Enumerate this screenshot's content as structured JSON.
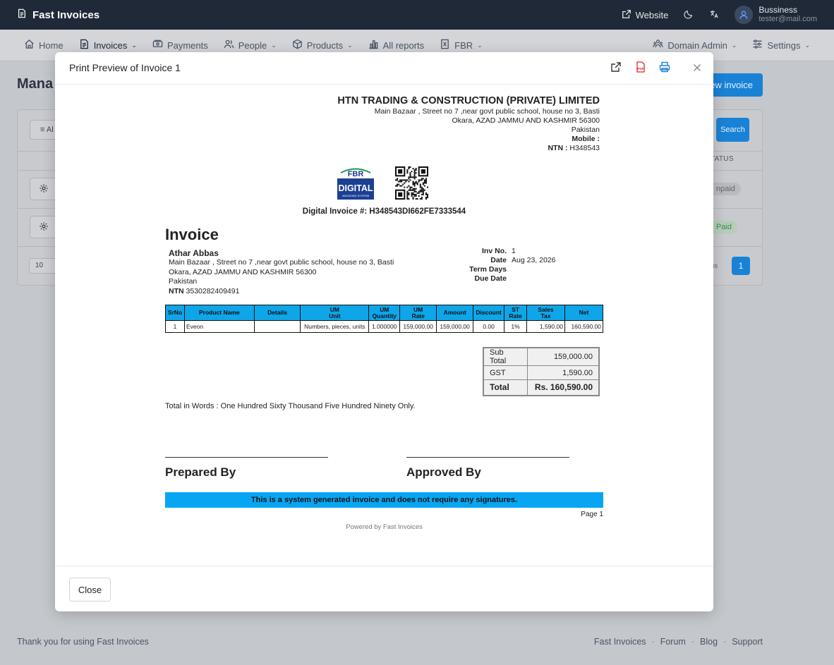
{
  "app": {
    "title": "Fast Invoices"
  },
  "topbar": {
    "website_label": "Website",
    "user_name": "Bussiness",
    "user_email": "tester@mail.com"
  },
  "nav": {
    "items": [
      {
        "label": "Home",
        "icon": "home-icon"
      },
      {
        "label": "Invoices",
        "icon": "file-icon"
      },
      {
        "label": "Payments",
        "icon": "payments-icon"
      },
      {
        "label": "People",
        "icon": "people-icon"
      },
      {
        "label": "Products",
        "icon": "box-icon"
      },
      {
        "label": "All reports",
        "icon": "chart-icon"
      },
      {
        "label": "FBR",
        "icon": "receipt-icon"
      }
    ],
    "right": [
      {
        "label": "Domain Admin",
        "icon": "team-icon"
      },
      {
        "label": "Settings",
        "icon": "sliders-icon"
      }
    ]
  },
  "page": {
    "title_partial": "Mana",
    "new_button": "ew invoice",
    "filter_partial": "≡ Al",
    "search_button": "Search",
    "status_header": "TATUS",
    "rows": [
      {
        "status": "npaid"
      },
      {
        "status": "Paid"
      }
    ],
    "per_page": "10",
    "items_partial": "ms",
    "current_page": "1"
  },
  "modal": {
    "title": "Print Preview of Invoice 1",
    "close_button": "Close"
  },
  "invoice": {
    "company": {
      "name": "HTN TRADING & CONSTRUCTION (PRIVATE) LIMITED",
      "address1": "Main Bazaar , Street no 7 ,near govt public school, house no 3, Basti",
      "address2": "Okara, AZAD JAMMU AND KASHMIR 56300",
      "country": "Pakistan",
      "mobile_label": "Mobile :",
      "ntn_label": "NTN :",
      "ntn": "H348543"
    },
    "fbr_logo": {
      "top": "FBR",
      "main": "DIGITAL",
      "sub": "INVOICING SYSTEM"
    },
    "digital_invoice": "Digital Invoice #: H348543DI662FE7333544",
    "heading": "Invoice",
    "customer": {
      "name": "Athar Abbas",
      "address1": "Main Bazaar , Street no 7 ,near govt public school, house no 3, Basti",
      "address2": "Okara, AZAD JAMMU AND KASHMIR 56300",
      "country": "Pakistan",
      "ntn_label": "NTN",
      "ntn": "3530282409491"
    },
    "meta": {
      "inv_no_label": "Inv No.",
      "inv_no": "1",
      "date_label": "Date",
      "date": "Aug 23, 2026",
      "term_days_label": "Term Days",
      "term_days": "",
      "due_date_label": "Due Date",
      "due_date": ""
    },
    "columns": [
      "SrNo",
      "Product Name",
      "Details",
      "UM\nUnit",
      "UM\nQuantity",
      "UM\nRate",
      "Amount",
      "Discount",
      "ST\nRate",
      "Sales\nTax",
      "Net"
    ],
    "rows": [
      {
        "srno": "1",
        "product": "Eveon",
        "details": "",
        "unit": "Numbers, pieces, units",
        "qty": "1.000000",
        "rate": "159,000.00",
        "amount": "159,000.00",
        "discount": "0.00",
        "st_rate": "1%",
        "sales_tax": "1,590.00",
        "net": "160,590.00"
      }
    ],
    "totals": {
      "subtotal_label": "Sub Total",
      "subtotal": "159,000.00",
      "gst_label": "GST",
      "gst": "1,590.00",
      "total_label": "Total",
      "total": "Rs. 160,590.00"
    },
    "words": "Total in Words : One Hundred Sixty Thousand Five Hundred Ninety Only.",
    "prepared_by": "Prepared By",
    "approved_by": "Approved By",
    "system_note": "This is a system generated invoice and does not require any signatures.",
    "page_label": "Page 1",
    "powered_by": "Powered by Fast Invoices"
  },
  "footer": {
    "thanks": "Thank you for using Fast Invoices",
    "links": [
      "Fast Invoices",
      "Forum",
      "Blog",
      "Support"
    ]
  },
  "colors": {
    "topbar": "#1f2937",
    "accent": "#1a82d6",
    "table_header": "#0ea5e9",
    "system_note": "#06a6f2",
    "fbr_blue": "#1b3f94",
    "fbr_green": "#1d9c4a",
    "pdf_red": "#dc2626"
  }
}
